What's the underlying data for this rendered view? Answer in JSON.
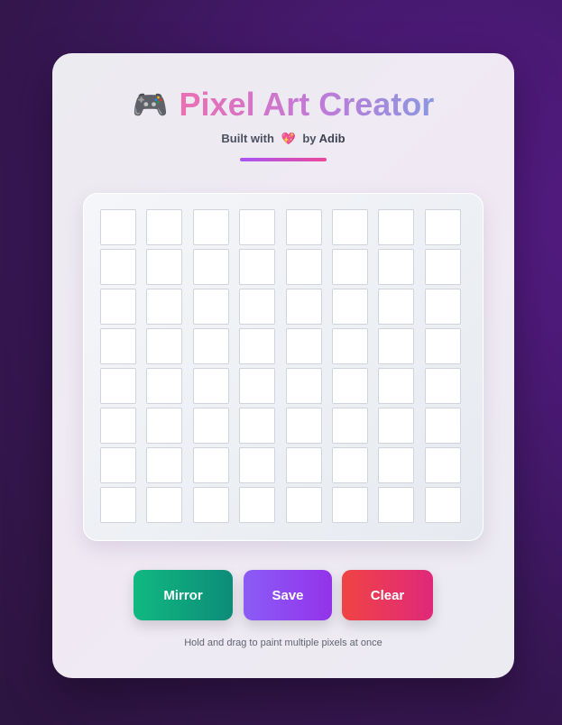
{
  "app": {
    "title_emoji": "🎮",
    "title": "Pixel Art Creator",
    "subtitle_prefix": "Built with",
    "subtitle_heart": "💖",
    "subtitle_by": "by",
    "subtitle_author": "Adib"
  },
  "grid": {
    "rows": 8,
    "cols": 8,
    "cell_color": "#ffffff",
    "border_color": "#cfd3da"
  },
  "buttons": {
    "mirror": "Mirror",
    "save": "Save",
    "clear": "Clear"
  },
  "hint": "Hold and drag to paint multiple pixels at once",
  "colors": {
    "background": "#46196e",
    "title_gradient_start": "#ec6fb3",
    "title_gradient_end": "#8b97e0",
    "mirror": "#10b981",
    "save": "#8b5cf6",
    "clear": "#ef4444"
  }
}
